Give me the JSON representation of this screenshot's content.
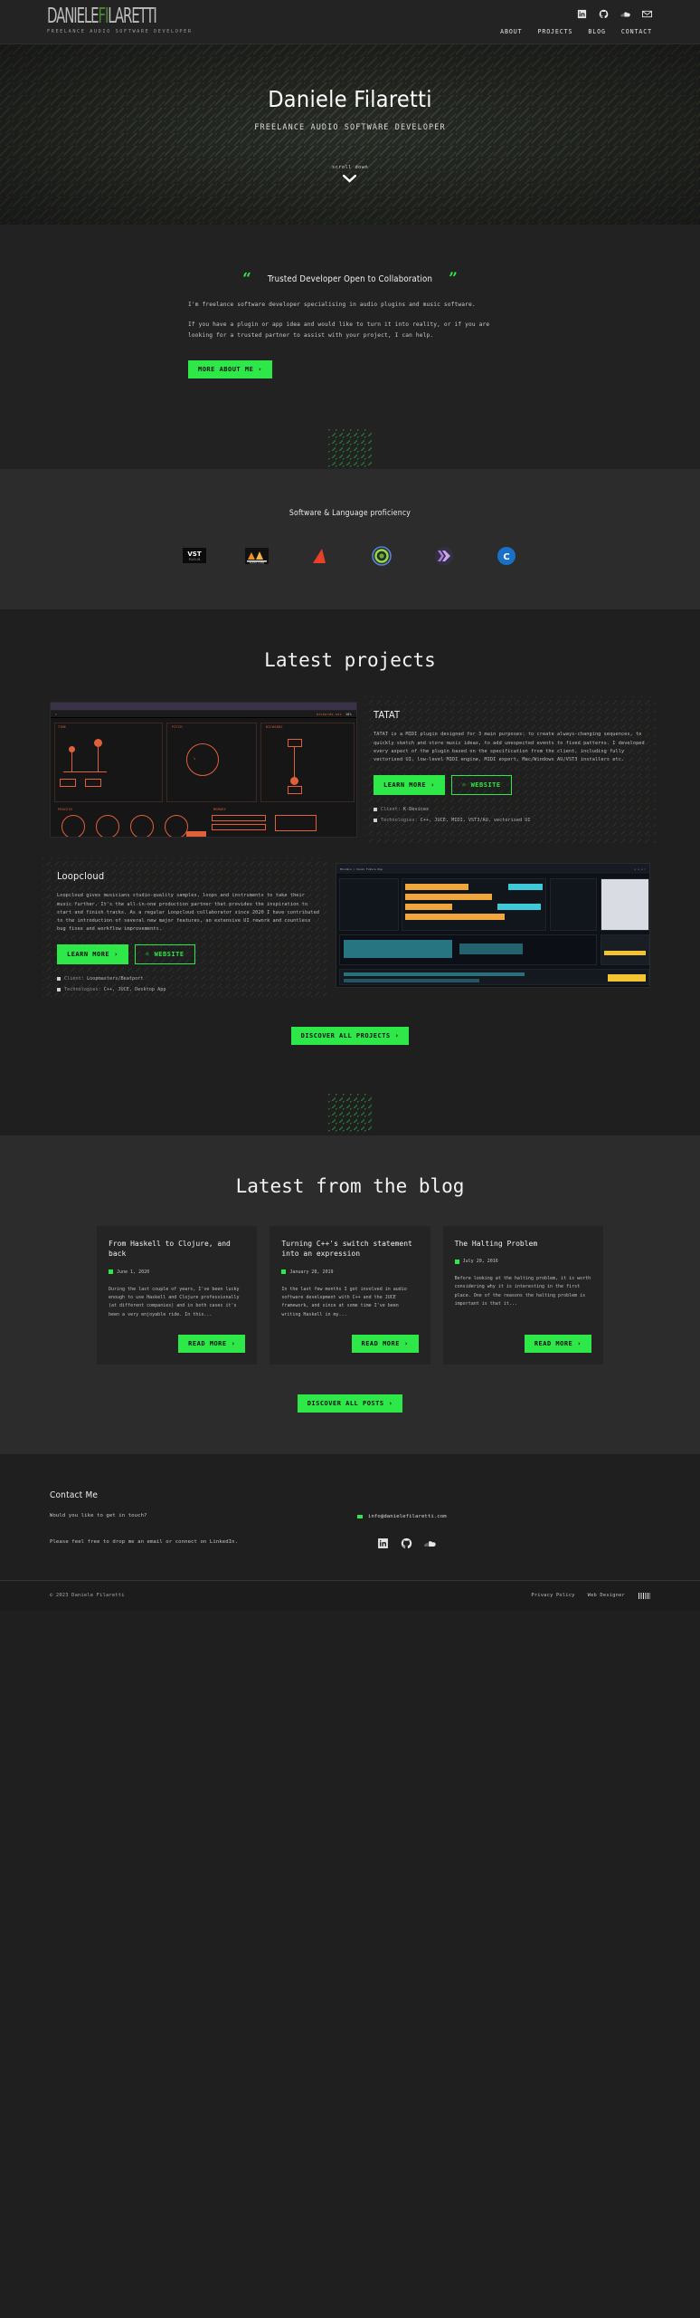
{
  "header": {
    "logo_main": "DANIELE",
    "logo_accent": "FI",
    "logo_rest": "LARETTI",
    "logo_tagline": "FREELANCE AUDIO SOFTWARE DEVELOPER",
    "social": [
      {
        "name": "linkedin-icon",
        "label": "LinkedIn"
      },
      {
        "name": "github-icon",
        "label": "GitHub"
      },
      {
        "name": "soundcloud-icon",
        "label": "SoundCloud"
      },
      {
        "name": "email-icon",
        "label": "Email"
      }
    ],
    "nav": [
      {
        "label": "ABOUT"
      },
      {
        "label": "PROJECTS"
      },
      {
        "label": "BLOG"
      },
      {
        "label": "CONTACT"
      }
    ]
  },
  "hero": {
    "title": "Daniele Filaretti",
    "subtitle": "FREELANCE AUDIO SOFTWARE DEVELOPER",
    "scroll_label": "scroll down",
    "scroll_icon": "chevron-down-icon"
  },
  "about": {
    "quote_open": "“",
    "quote_close": "”",
    "heading": "Trusted Developer Open to Collaboration",
    "paragraph1": "I'm freelance software developer specialising in audio plugins and music software.",
    "paragraph2": "If you have a plugin or app idea and would like to turn it into reality, or if you are looking for a trusted partner to assist with your project, I can help.",
    "cta_label": "MORE ABOUT ME",
    "cta_arrow": "›"
  },
  "skills": {
    "title": "Software & Language proficiency",
    "items": [
      {
        "name": "vst-logo",
        "label": "VST"
      },
      {
        "name": "juce-logo",
        "label": "JUCE"
      },
      {
        "name": "ableton-live-logo",
        "label": "Ableton Live"
      },
      {
        "name": "clojure-logo",
        "label": "Clojure"
      },
      {
        "name": "haskell-logo",
        "label": "Haskell"
      },
      {
        "name": "cpp-logo",
        "label": "C++"
      }
    ]
  },
  "projects": {
    "title": "Latest projects",
    "items": [
      {
        "name": "TATAT",
        "description": "TATAT is a MIDI plugin designed for 3 main purposes: to create always-changing sequences, to quickly sketch and store music ideas, to add unexpected events to fixed patterns. I developed every aspect of the plugin based on the specification from the client, including fully vectorised UI, low-level MIDI engine, MIDI export, Mac/Windows AU/VST3 installers etc.",
        "buttons": [
          {
            "label": "LEARN MORE",
            "style": "solid",
            "icon": "arrow-right-icon"
          },
          {
            "label": "WEBSITE",
            "style": "outline",
            "icon": "external-link-icon"
          }
        ],
        "meta": [
          {
            "key": "Client:",
            "value": "K-Devices",
            "icon": "client-icon"
          },
          {
            "key": "Technologies:",
            "value": "C++, JUCE, MIDI, VST3/AU, vectorised UI",
            "icon": "tech-icon"
          }
        ],
        "screenshot": "tatat-plugin-ui",
        "screenshot_side": "left"
      },
      {
        "name": "Loopcloud",
        "description": "Loopcloud gives musicians studio-quality samples, loops and instruments to take their music further. It's the all-in-one production partner that provides the inspiration to start and finish tracks. As a regular Loopcloud collaborator since 2020 I have contributed to the introduction of several new major features, an extensive UI rework and countless bug fixes and workflow improvements.",
        "buttons": [
          {
            "label": "LEARN MORE",
            "style": "solid",
            "icon": "arrow-right-icon"
          },
          {
            "label": "WEBSITE",
            "style": "outline",
            "icon": "external-link-icon"
          }
        ],
        "meta": [
          {
            "key": "Client:",
            "value": "Loopmasters/Beatport",
            "icon": "client-icon"
          },
          {
            "key": "Technologies:",
            "value": "C++, JUCE, Desktop App",
            "icon": "tech-icon"
          }
        ],
        "screenshot": "loopcloud-app-ui",
        "screenshot_side": "right"
      }
    ],
    "discover_label": "DISCOVER ALL PROJECTS",
    "discover_arrow": "›"
  },
  "blog": {
    "title": "Latest from the blog",
    "posts": [
      {
        "title": "From Haskell to Clojure, and back",
        "date": "June 1, 2020",
        "excerpt": "During the last couple of years, I've been lucky enough to use Haskell and Clojure professionally (at different companies) and in both cases it's been a very enjoyable ride. In this...",
        "read_more": "READ MORE"
      },
      {
        "title": "Turning C++'s switch statement into an expression",
        "date": "January 28, 2019",
        "excerpt": "In the last few months I got involved in audio software development with C++ and the JUCE framework, and since at some time I've been writing Haskell in my...",
        "read_more": "READ MORE"
      },
      {
        "title": "The Halting Problem",
        "date": "July 20, 2016",
        "excerpt": "Before looking at the halting problem, it is worth considering why it is interesting in the first place. One of the reasons the halting problem is important is that it...",
        "read_more": "READ MORE"
      }
    ],
    "all_posts_label": "DISCOVER ALL POSTS",
    "all_posts_arrow": "›"
  },
  "contact": {
    "heading": "Contact Me",
    "question": "Would you like to get in touch?",
    "paragraph": "Please feel free to drop me an email or connect on LinkedIn.",
    "email": "info@danielefilaretti.com",
    "social": [
      {
        "name": "linkedin-icon",
        "label": "LinkedIn"
      },
      {
        "name": "github-icon",
        "label": "GitHub"
      },
      {
        "name": "soundcloud-icon",
        "label": "SoundCloud"
      }
    ]
  },
  "footer": {
    "copyright": "© 2023 Daniele Filaretti",
    "links": [
      {
        "label": "Privacy Policy"
      },
      {
        "label": "Web Designer"
      }
    ],
    "designer_logo": "alabhal-logo"
  },
  "colors": {
    "accent": "#2ee84a",
    "bg_dark": "#1f1f1f",
    "bg_mid": "#222222",
    "bg_light": "#2c2c2c",
    "header": "#232323"
  }
}
